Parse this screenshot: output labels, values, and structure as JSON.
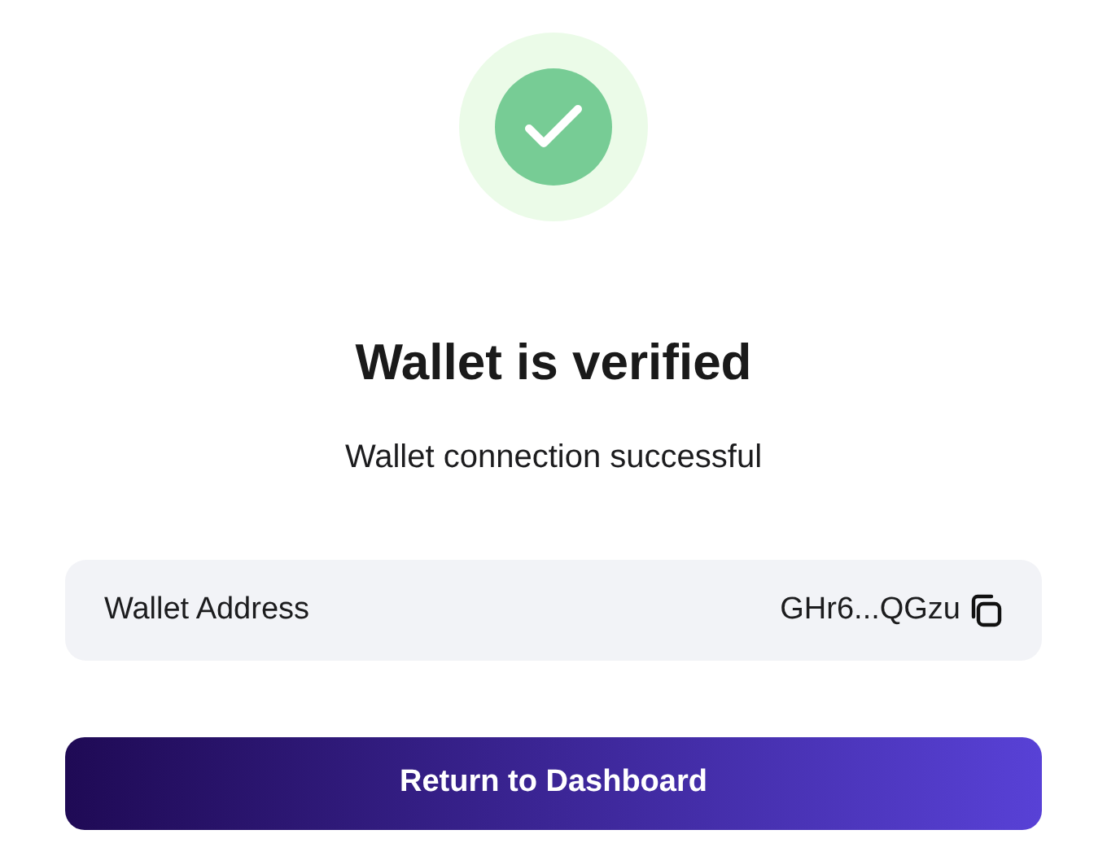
{
  "title": "Wallet is verified",
  "subtitle": "Wallet connection successful",
  "address": {
    "label": "Wallet Address",
    "value": "GHr6...QGzu"
  },
  "button": "Return to Dashboard"
}
